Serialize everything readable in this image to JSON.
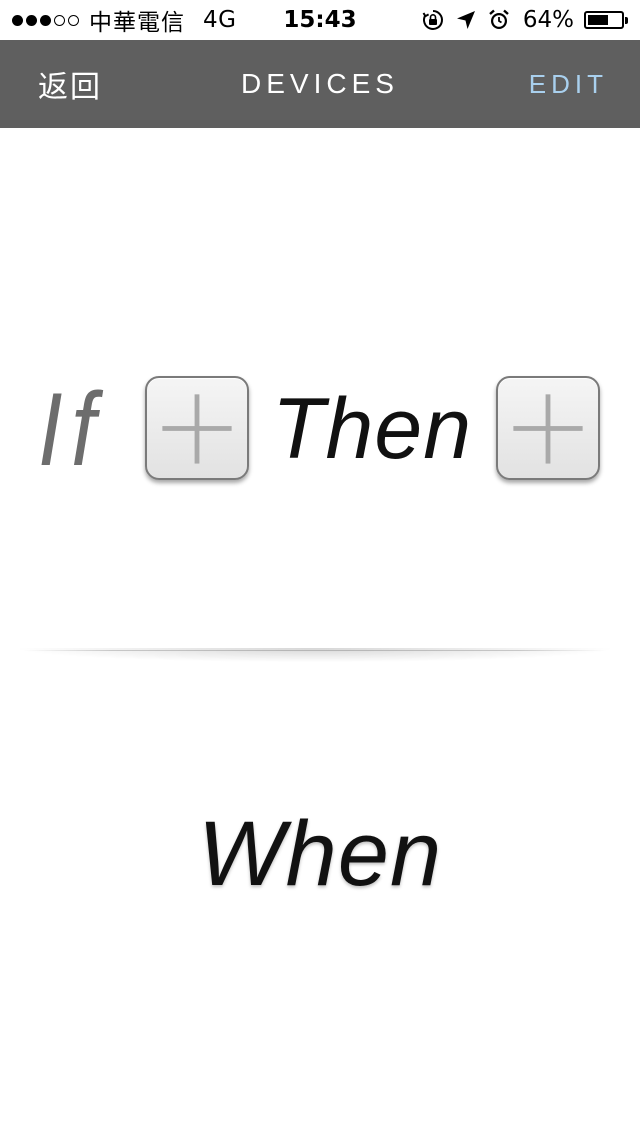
{
  "status_bar": {
    "signal_filled": 3,
    "signal_total": 5,
    "carrier": "中華電信",
    "network": "4G",
    "time": "15:43",
    "battery_percent_text": "64%",
    "battery_level": 0.64,
    "icons": [
      "rotation-lock-icon",
      "location-arrow-icon",
      "alarm-clock-icon",
      "battery-icon"
    ]
  },
  "nav": {
    "back_label": "返回",
    "title": "DEVICES",
    "edit_label": "EDIT",
    "background_color": "#5f5f5f",
    "edit_color": "#a9d0ee"
  },
  "rule": {
    "if_label": "If",
    "then_label": "Then",
    "when_label": "When",
    "add_condition_icon": "plus-icon",
    "add_action_icon": "plus-icon"
  }
}
